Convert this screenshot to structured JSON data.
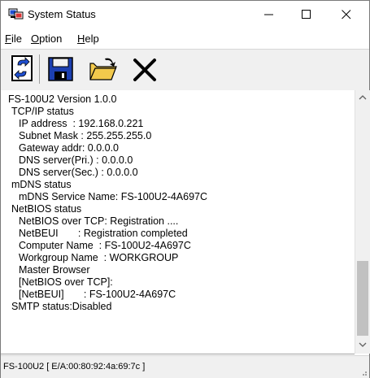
{
  "window": {
    "title": "System Status"
  },
  "menu": {
    "file": "File",
    "option": "Option",
    "help": "Help"
  },
  "toolbar": {
    "buttons": [
      {
        "name": "refresh",
        "icon": "refresh-icon"
      },
      {
        "name": "save",
        "icon": "save-disk-icon"
      },
      {
        "name": "open",
        "icon": "open-folder-icon"
      },
      {
        "name": "delete",
        "icon": "delete-x-icon"
      }
    ]
  },
  "status": {
    "lines": [
      "FS-100U2 Version 1.0.0",
      "TCP/IP status",
      "IP address  : 192.168.0.221",
      "Subnet Mask : 255.255.255.0",
      "Gateway addr: 0.0.0.0",
      "DNS server(Pri.) : 0.0.0.0",
      "DNS server(Sec.) : 0.0.0.0",
      "mDNS status",
      "mDNS Service Name: FS-100U2-4A697C",
      "NetBIOS status",
      "NetBIOS over TCP: Registration ....",
      "NetBEUI       : Registration completed",
      "Computer Name  : FS-100U2-4A697C",
      "Workgroup Name  : WORKGROUP",
      "Master Browser",
      "[NetBIOS over TCP]:",
      "[NetBEUI]       : FS-100U2-4A697C",
      "SMTP status:Disabled"
    ]
  },
  "statusbar": {
    "text": "FS-100U2 [ E/A:00:80:92:4a:69:7c ]"
  },
  "colors": {
    "accent_blue": "#1f4fd1",
    "folder_yellow": "#f2c94c",
    "disk_blue": "#1c3fb0"
  }
}
